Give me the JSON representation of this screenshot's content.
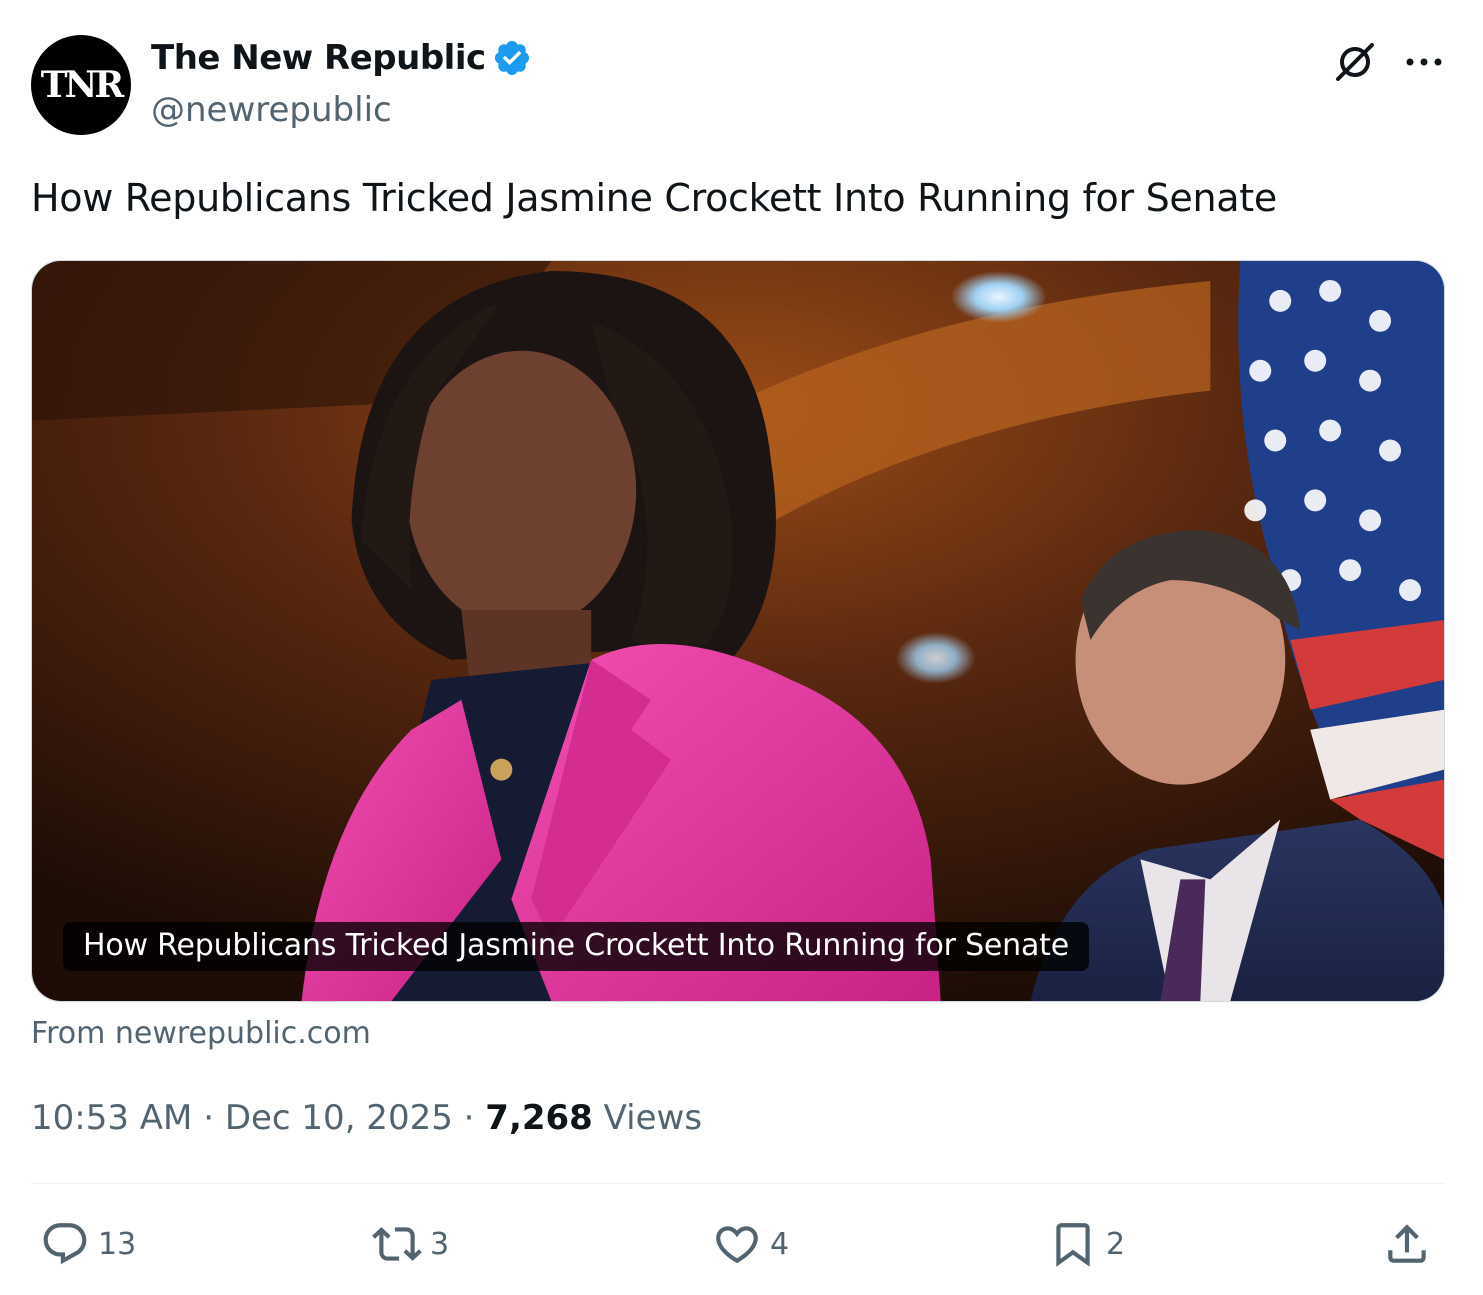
{
  "author": {
    "avatar_text": "TNR",
    "display_name": "The New Republic",
    "handle": "@newrepublic",
    "verified_color": "#1d9bf0"
  },
  "header_icons": [
    "grok-icon",
    "more-icon"
  ],
  "tweet": {
    "text": "How Republicans Tricked Jasmine Crockett Into Running for Senate"
  },
  "card": {
    "caption": "How Republicans Tricked Jasmine Crockett Into Running for Senate",
    "source": "From newrepublic.com"
  },
  "meta": {
    "time": "10:53 AM",
    "separator": "·",
    "date": "Dec 10, 2025",
    "views_count": "7,268",
    "views_label": "Views"
  },
  "actions": {
    "replies": "13",
    "reposts": "3",
    "likes": "4",
    "bookmarks": "2"
  },
  "colors": {
    "text_primary": "#0f1419",
    "text_secondary": "#536471",
    "accent": "#1d9bf0",
    "blazer": "#e0399e"
  }
}
